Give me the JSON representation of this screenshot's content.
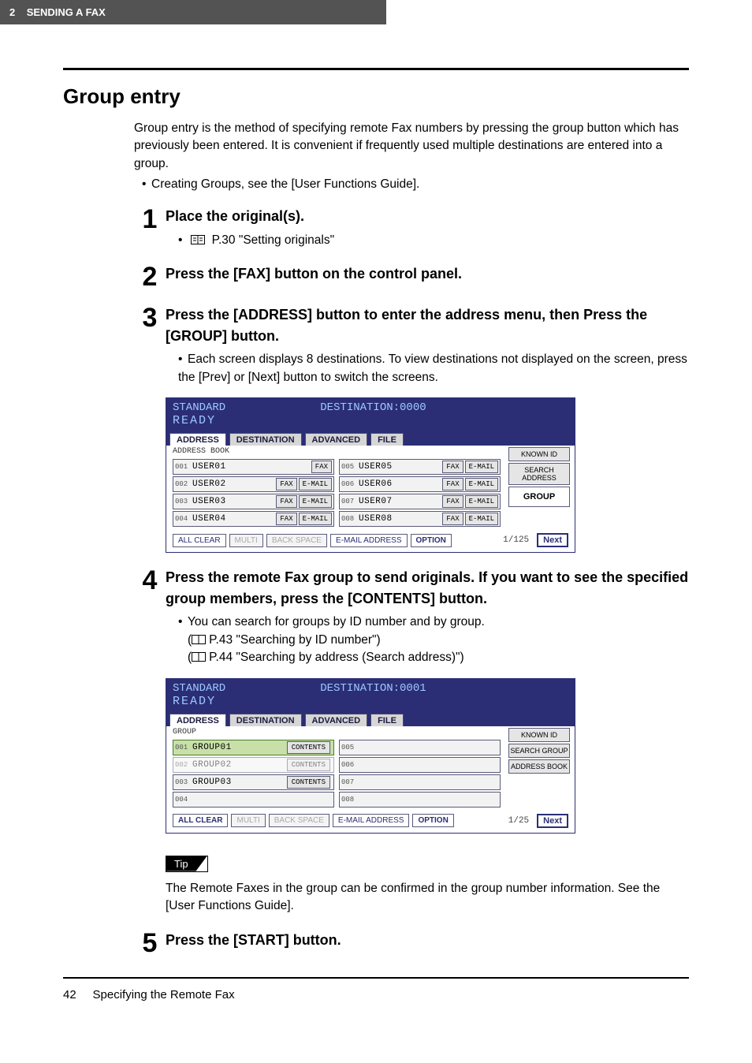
{
  "header": {
    "chapter": "2",
    "title": "SENDING A FAX"
  },
  "page_title": "Group entry",
  "intro": "Group entry is the method of specifying remote Fax numbers by pressing the group button which has previously been entered. It is convenient if frequently used multiple destinations are entered into a group.",
  "intro_bullet": "Creating Groups, see the [User Functions Guide].",
  "steps": {
    "1": {
      "title": "Place the original(s).",
      "ref": "P.30 \"Setting originals\""
    },
    "2": {
      "title": "Press the [FAX] button on the control panel."
    },
    "3": {
      "title": "Press the [ADDRESS] button to enter the address menu, then Press the [GROUP] button.",
      "bullet": "Each screen displays 8 destinations. To view destinations not displayed on the screen, press the [Prev] or [Next] button to switch the screens."
    },
    "4": {
      "title": "Press the remote Fax group to send originals. If you want to see the specified group members, press the [CONTENTS] button.",
      "bullet": "You can search for groups by ID number and by group.",
      "ref1": "P.43 \"Searching by ID number\"",
      "ref2": "P.44 \"Searching by address (Search address)\""
    },
    "5": {
      "title": "Press the [START] button."
    }
  },
  "screen1": {
    "mode": "STANDARD",
    "dest": "DESTINATION:0000",
    "ready": "READY",
    "tabs": {
      "address": "ADDRESS",
      "destination": "DESTINATION",
      "advanced": "ADVANCED",
      "file": "FILE"
    },
    "sublabel": "ADDRESS BOOK",
    "rows": [
      {
        "id": "001",
        "name": "USER01",
        "fax": true,
        "email": false
      },
      {
        "id": "002",
        "name": "USER02",
        "fax": true,
        "email": true
      },
      {
        "id": "003",
        "name": "USER03",
        "fax": true,
        "email": true
      },
      {
        "id": "004",
        "name": "USER04",
        "fax": true,
        "email": true
      },
      {
        "id": "005",
        "name": "USER05",
        "fax": true,
        "email": true
      },
      {
        "id": "006",
        "name": "USER06",
        "fax": true,
        "email": true
      },
      {
        "id": "007",
        "name": "USER07",
        "fax": true,
        "email": true
      },
      {
        "id": "008",
        "name": "USER08",
        "fax": true,
        "email": true
      }
    ],
    "side": {
      "known": "KNOWN ID",
      "search": "SEARCH ADDRESS",
      "group": "GROUP"
    },
    "bottom": {
      "allclear": "ALL CLEAR",
      "multi": "MULTI",
      "backspace": "BACK SPACE",
      "email": "E-MAIL ADDRESS",
      "option": "OPTION",
      "page": "1/125",
      "next": "Next"
    },
    "fax_label": "FAX",
    "email_label": "E-MAIL"
  },
  "screen2": {
    "mode": "STANDARD",
    "dest": "DESTINATION:0001",
    "ready": "READY",
    "tabs": {
      "address": "ADDRESS",
      "destination": "DESTINATION",
      "advanced": "ADVANCED",
      "file": "FILE"
    },
    "sublabel": "GROUP",
    "rows": [
      {
        "id": "001",
        "name": "GROUP01",
        "contents": "CONTENTS",
        "selected": true
      },
      {
        "id": "002",
        "name": "GROUP02",
        "contents": "CONTENTS"
      },
      {
        "id": "003",
        "name": "GROUP03",
        "contents": "CONTENTS"
      },
      {
        "id": "004",
        "name": "",
        "contents": ""
      },
      {
        "id": "005",
        "name": "",
        "contents": ""
      },
      {
        "id": "006",
        "name": "",
        "contents": ""
      },
      {
        "id": "007",
        "name": "",
        "contents": ""
      },
      {
        "id": "008",
        "name": "",
        "contents": ""
      }
    ],
    "side": {
      "known": "KNOWN ID",
      "search": "SEARCH GROUP",
      "addrbook": "ADDRESS BOOK"
    },
    "bottom": {
      "allclear": "ALL CLEAR",
      "multi": "MULTI",
      "backspace": "BACK SPACE",
      "email": "E-MAIL ADDRESS",
      "option": "OPTION",
      "page": "1/25",
      "next": "Next"
    }
  },
  "tip": {
    "label": "Tip",
    "text": "The Remote Faxes in the group can be confirmed in the group number information. See the [User Functions Guide]."
  },
  "footer": {
    "page": "42",
    "section": "Specifying the Remote Fax"
  }
}
